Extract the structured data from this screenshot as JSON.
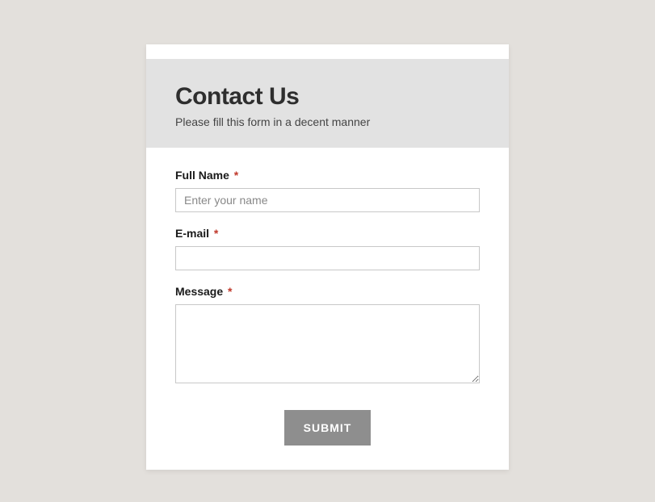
{
  "header": {
    "title": "Contact Us",
    "subtitle": "Please fill this form in a decent manner"
  },
  "form": {
    "fullName": {
      "label": "Full Name",
      "required": "*",
      "placeholder": "Enter your name",
      "value": ""
    },
    "email": {
      "label": "E-mail",
      "required": "*",
      "value": ""
    },
    "message": {
      "label": "Message",
      "required": "*",
      "value": ""
    },
    "submit": {
      "label": "SUBMIT"
    }
  }
}
